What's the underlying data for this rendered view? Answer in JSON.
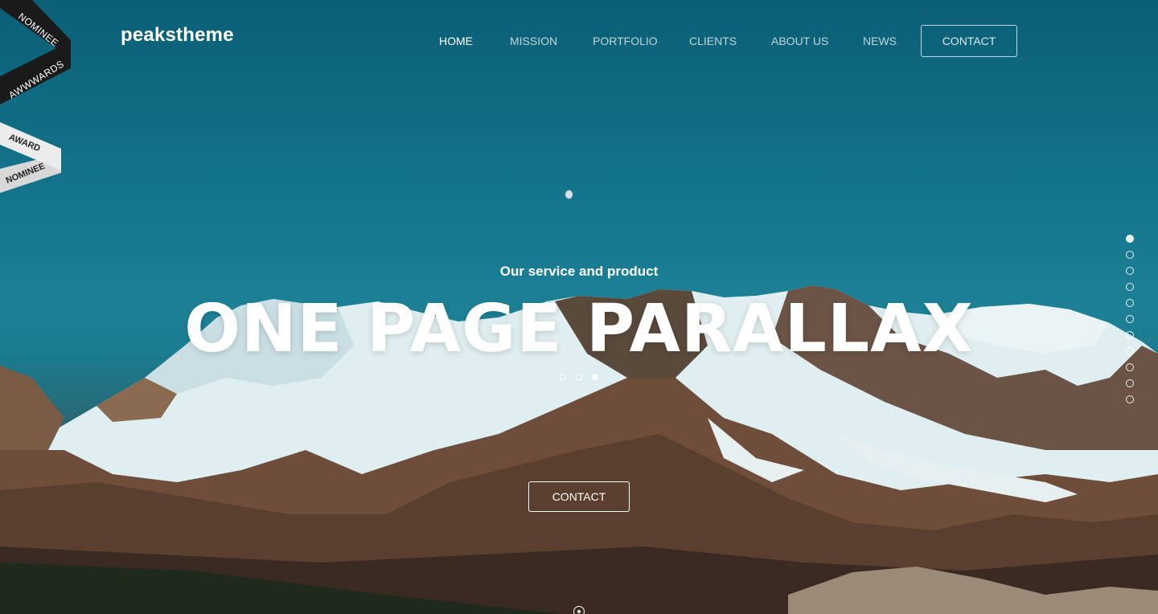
{
  "brand": {
    "name": "peakstheme"
  },
  "nav": {
    "items": [
      {
        "label": "HOME",
        "active": true
      },
      {
        "label": "MISSION",
        "active": false
      },
      {
        "label": "PORTFOLIO",
        "active": false
      },
      {
        "label": "CLIENTS",
        "active": false
      },
      {
        "label": "ABOUT US",
        "active": false
      },
      {
        "label": "NEWS",
        "active": false
      }
    ],
    "contact_label": "CONTACT"
  },
  "badges": {
    "awwwards_top": "NOMINEE",
    "awwwards_bottom": "AWWWARDS",
    "award_top": "AWARD",
    "award_bottom": "NOMINEE"
  },
  "hero": {
    "tagline": "Our service and product",
    "headline": "ONE PAGE PARALLAX",
    "cta_label": "CONTACT",
    "slides_count": 3,
    "active_slide": 3
  },
  "side_nav": {
    "count": 11,
    "active_index": 1
  },
  "colors": {
    "sky": "#13738a",
    "text": "#ffffff"
  }
}
